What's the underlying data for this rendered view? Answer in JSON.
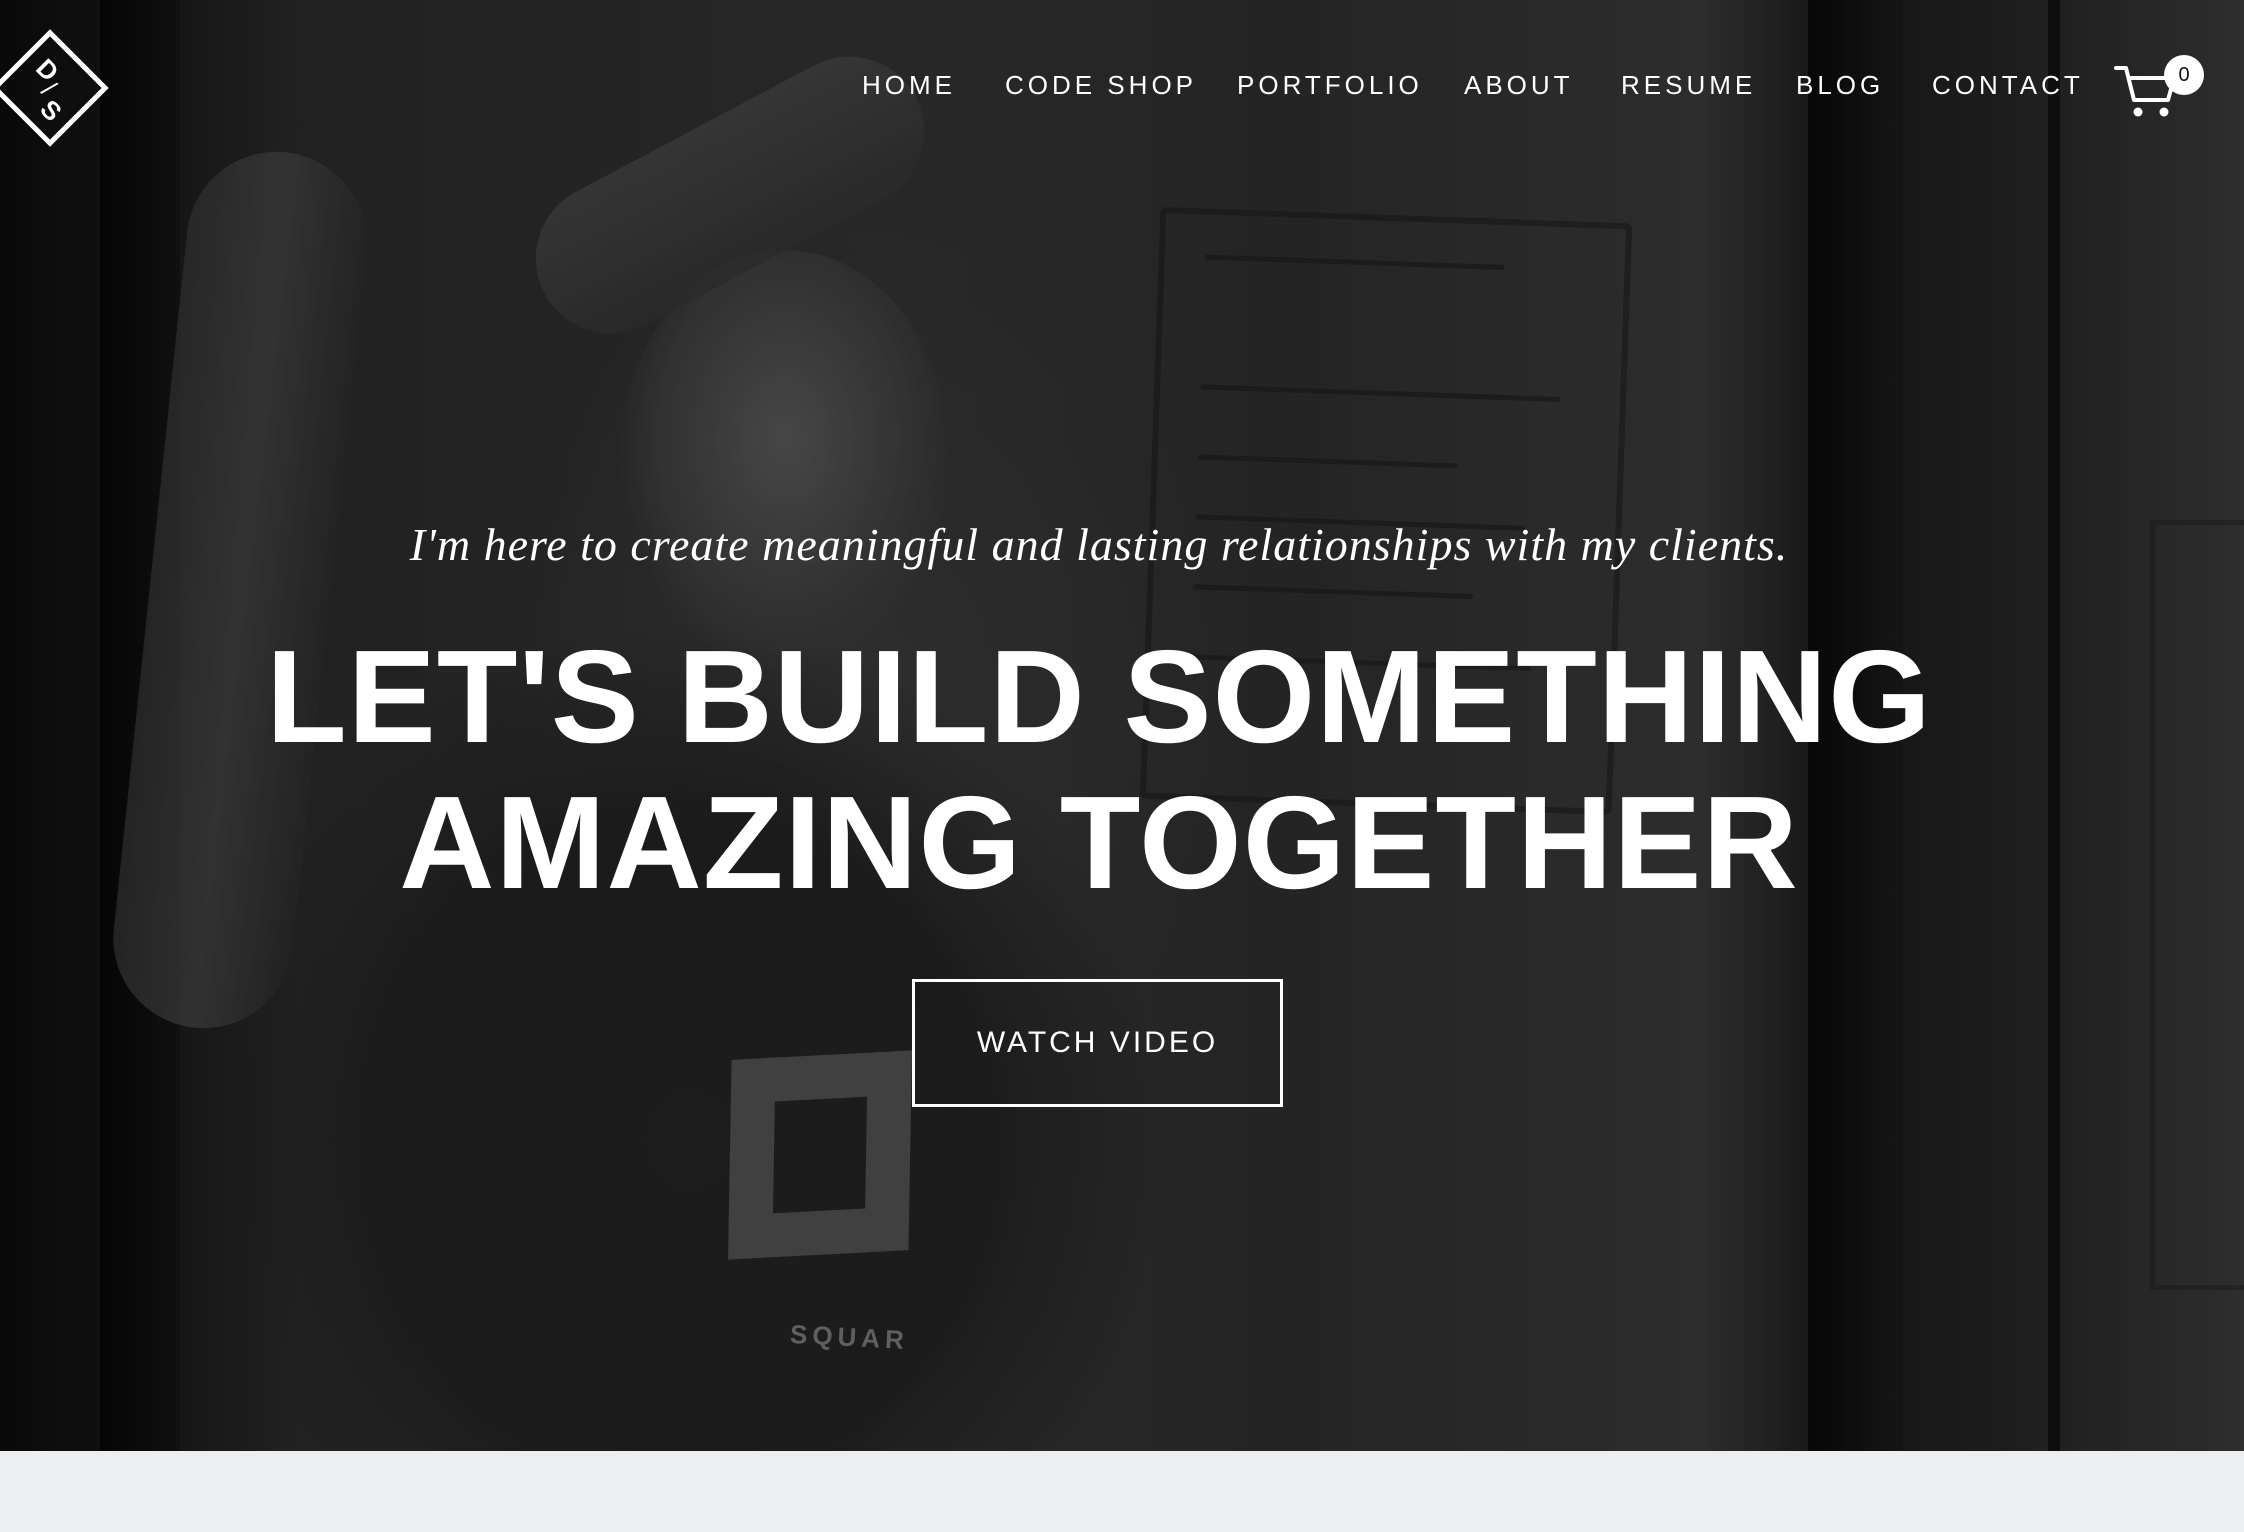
{
  "logo": {
    "letters": [
      "D",
      "/",
      "S"
    ],
    "icon": "diamond-monogram-logo"
  },
  "nav": {
    "items": [
      {
        "label": "HOME"
      },
      {
        "label": "CODE SHOP"
      },
      {
        "label": "PORTFOLIO"
      },
      {
        "label": "ABOUT"
      },
      {
        "label": "RESUME"
      },
      {
        "label": "BLOG"
      },
      {
        "label": "CONTACT"
      }
    ],
    "cart": {
      "icon": "shopping-cart-icon",
      "count": "0"
    }
  },
  "hero": {
    "tagline": "I'm here to create meaningful and lasting relationships with my clients.",
    "headline_line1": "LET'S BUILD SOMETHING",
    "headline_line2": "AMAZING TOGETHER",
    "button_label": "WATCH VIDEO",
    "shirt_text": "SQUAR"
  },
  "colors": {
    "text": "#ffffff",
    "hero_bg": "#2f2f2f",
    "below_bg": "#eceef0"
  }
}
